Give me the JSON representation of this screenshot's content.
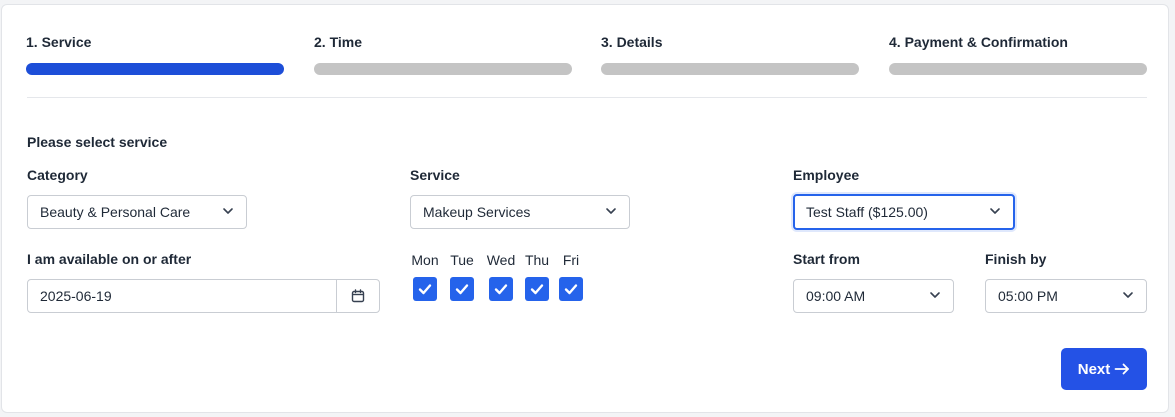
{
  "steps": [
    {
      "label": "1. Service",
      "active": true
    },
    {
      "label": "2. Time",
      "active": false
    },
    {
      "label": "3. Details",
      "active": false
    },
    {
      "label": "4. Payment & Confirmation",
      "active": false
    }
  ],
  "form": {
    "section_title": "Please select service",
    "category": {
      "label": "Category",
      "value": "Beauty & Personal Care"
    },
    "service": {
      "label": "Service",
      "value": "Makeup Services"
    },
    "employee": {
      "label": "Employee",
      "value": "Test Staff ($125.00)"
    },
    "availability": {
      "label": "I am available on or after",
      "value": "2025-06-19"
    },
    "days": [
      {
        "label": "Mon",
        "checked": true
      },
      {
        "label": "Tue",
        "checked": true
      },
      {
        "label": "Wed",
        "checked": true
      },
      {
        "label": "Thu",
        "checked": true
      },
      {
        "label": "Fri",
        "checked": true
      }
    ],
    "start_from": {
      "label": "Start from",
      "value": "09:00 AM"
    },
    "finish_by": {
      "label": "Finish by",
      "value": "05:00 PM"
    }
  },
  "actions": {
    "next_label": "Next",
    "next_icon": "arrow-right-icon"
  },
  "colors": {
    "accent": "#2452e6",
    "step_active": "#1d4ed8",
    "step_inactive": "#c4c4c4"
  }
}
